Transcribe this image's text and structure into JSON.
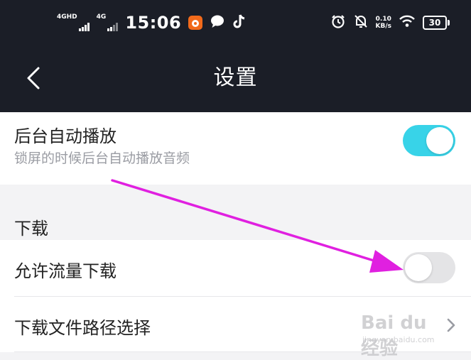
{
  "status_bar": {
    "network_1": "4GHD",
    "network_2": "4G",
    "time": "15:06",
    "speed_value": "0.10",
    "speed_unit": "KB/s",
    "battery": "30"
  },
  "nav": {
    "title": "设置"
  },
  "rows": {
    "background_play": {
      "title": "后台自动播放",
      "subtitle": "锁屏的时候后台自动播放音频",
      "toggle_on": true
    },
    "download_section": {
      "label": "下载"
    },
    "allow_data_download": {
      "title": "允许流量下载",
      "toggle_on": false
    },
    "download_path": {
      "title": "下载文件路径选择"
    }
  },
  "watermark": {
    "logo": "Bai du 经验",
    "site": "jingyan.baidu.com"
  },
  "colors": {
    "header_bg": "#1b1e27",
    "toggle_on": "#38d3e8",
    "toggle_off": "#e4e4e6",
    "annotation_arrow": "#e020e0"
  }
}
